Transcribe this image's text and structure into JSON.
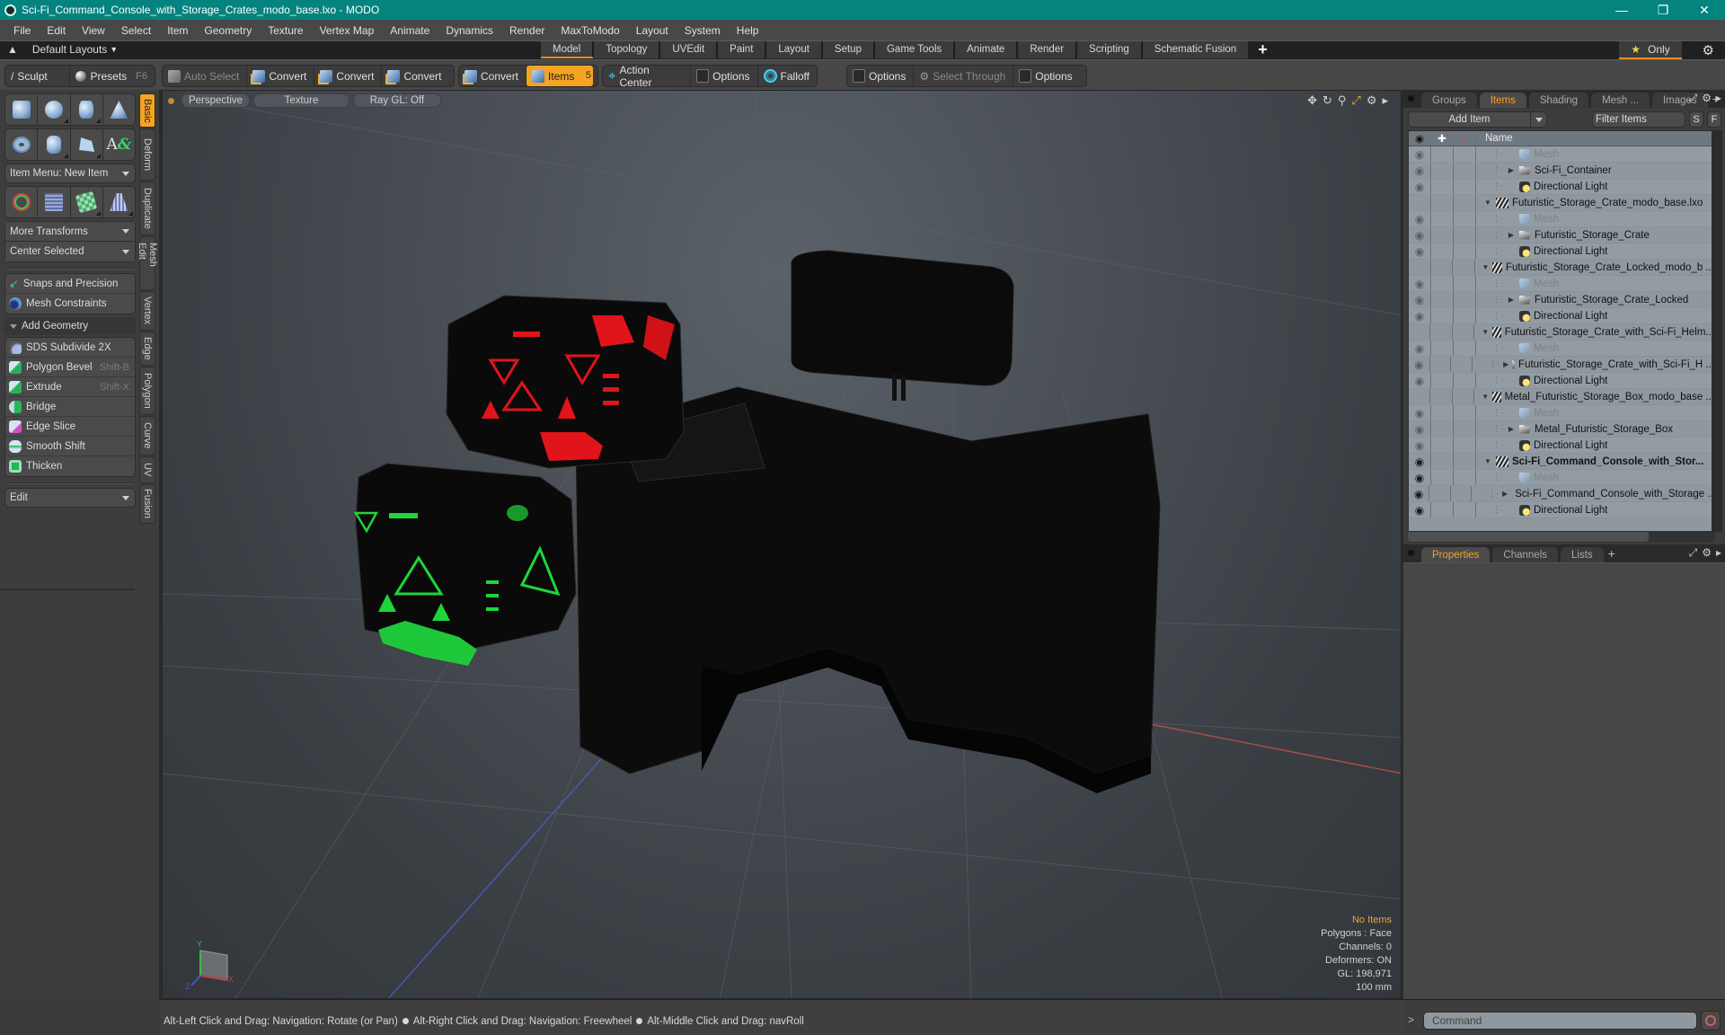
{
  "window": {
    "title": "Sci-Fi_Command_Console_with_Storage_Crates_modo_base.lxo - MODO",
    "controls": [
      "minimize",
      "maximize",
      "close"
    ]
  },
  "menu": [
    "File",
    "Edit",
    "View",
    "Select",
    "Item",
    "Geometry",
    "Texture",
    "Vertex Map",
    "Animate",
    "Dynamics",
    "Render",
    "MaxToModo",
    "Layout",
    "System",
    "Help"
  ],
  "layout_bar": {
    "layouts_label": "Default Layouts",
    "tabs": [
      {
        "label": "Model",
        "active": true
      },
      {
        "label": "Topology",
        "active": false
      },
      {
        "label": "UVEdit",
        "active": false
      },
      {
        "label": "Paint",
        "active": false
      },
      {
        "label": "Layout",
        "active": false
      },
      {
        "label": "Setup",
        "active": false
      },
      {
        "label": "Game Tools",
        "active": false
      },
      {
        "label": "Animate",
        "active": false
      },
      {
        "label": "Render",
        "active": false
      },
      {
        "label": "Scripting",
        "active": false
      },
      {
        "label": "Schematic Fusion",
        "active": false
      }
    ],
    "add_tab": "+",
    "only_label": "Only"
  },
  "toolbar": {
    "sculpt": "Sculpt",
    "presets": "Presets",
    "presets_hotkey": "F6",
    "auto_select": "Auto Select",
    "convert1": "Convert",
    "convert2": "Convert",
    "convert3": "Convert",
    "convert4": "Convert",
    "items": "Items",
    "items_count": "5",
    "action_center": "Action Center",
    "options1": "Options",
    "falloff": "Falloff",
    "options2": "Options",
    "select_through": "Select Through",
    "options3": "Options"
  },
  "left_panel": {
    "item_menu": "Item Menu: New Item",
    "more_transforms": "More Transforms",
    "center_selected": "Center Selected",
    "snaps": "Snaps and Precision",
    "mesh_constraints": "Mesh Constraints",
    "add_geometry": "Add Geometry",
    "tools": [
      {
        "label": "SDS Subdivide 2X",
        "hotkey": ""
      },
      {
        "label": "Polygon Bevel",
        "hotkey": "Shift-B"
      },
      {
        "label": "Extrude",
        "hotkey": "Shift-X"
      },
      {
        "label": "Bridge",
        "hotkey": ""
      },
      {
        "label": "Edge Slice",
        "hotkey": ""
      },
      {
        "label": "Smooth Shift",
        "hotkey": ""
      },
      {
        "label": "Thicken",
        "hotkey": ""
      }
    ],
    "edit_dropdown": "Edit",
    "vertical_tabs": [
      {
        "label": "Basic",
        "active": true
      },
      {
        "label": "Deform",
        "active": false
      },
      {
        "label": "Duplicate",
        "active": false
      },
      {
        "label": "Mesh Edit",
        "active": false
      },
      {
        "label": "Vertex",
        "active": false
      },
      {
        "label": "Edge",
        "active": false
      },
      {
        "label": "Polygon",
        "active": false
      },
      {
        "label": "Curve",
        "active": false
      },
      {
        "label": "UV",
        "active": false
      },
      {
        "label": "Fusion",
        "active": false
      }
    ]
  },
  "viewport": {
    "view": "Perspective",
    "shading": "Texture",
    "raygl": "Ray GL: Off",
    "stats": {
      "selection": "No Items",
      "polygons": "Polygons : Face",
      "channels": "Channels: 0",
      "deformers": "Deformers: ON",
      "gl": "GL: 198,971",
      "scale": "100 mm"
    },
    "axis_labels": {
      "x": "X",
      "y": "Y",
      "z": "Z"
    }
  },
  "right_panel": {
    "top_tabs": [
      {
        "label": "Groups",
        "active": false
      },
      {
        "label": "Items",
        "active": true
      },
      {
        "label": "Shading",
        "active": false
      },
      {
        "label": "Mesh ...",
        "active": false
      },
      {
        "label": "Images",
        "active": false
      }
    ],
    "add_item": "Add Item",
    "filter_items": "Filter Items",
    "s_btn": "S",
    "f_btn": "F",
    "column_name": "Name",
    "items": [
      {
        "name": "Mesh",
        "type": "mesh",
        "level": 2,
        "visible": true,
        "dim": true
      },
      {
        "name": "Sci-Fi_Container",
        "type": "group",
        "level": 2,
        "visible": true,
        "expandable": true
      },
      {
        "name": "Directional Light",
        "type": "light",
        "level": 2,
        "visible": true
      },
      {
        "name": "Futuristic_Storage_Crate_modo_base.lxo",
        "type": "scene",
        "level": 1,
        "visible": false,
        "expanded": true
      },
      {
        "name": "Mesh",
        "type": "mesh",
        "level": 2,
        "visible": true,
        "dim": true
      },
      {
        "name": "Futuristic_Storage_Crate",
        "type": "group",
        "level": 2,
        "visible": true,
        "expandable": true
      },
      {
        "name": "Directional Light",
        "type": "light",
        "level": 2,
        "visible": true
      },
      {
        "name": "Futuristic_Storage_Crate_Locked_modo_b ...",
        "type": "scene",
        "level": 1,
        "visible": false,
        "expanded": true
      },
      {
        "name": "Mesh",
        "type": "mesh",
        "level": 2,
        "visible": true,
        "dim": true
      },
      {
        "name": "Futuristic_Storage_Crate_Locked",
        "type": "group",
        "level": 2,
        "visible": true,
        "expandable": true
      },
      {
        "name": "Directional Light",
        "type": "light",
        "level": 2,
        "visible": true
      },
      {
        "name": "Futuristic_Storage_Crate_with_Sci-Fi_Helm...",
        "type": "scene",
        "level": 1,
        "visible": false,
        "expanded": true
      },
      {
        "name": "Mesh",
        "type": "mesh",
        "level": 2,
        "visible": true,
        "dim": true
      },
      {
        "name": "Futuristic_Storage_Crate_with_Sci-Fi_H ...",
        "type": "group",
        "level": 2,
        "visible": true,
        "expandable": true
      },
      {
        "name": "Directional Light",
        "type": "light",
        "level": 2,
        "visible": true
      },
      {
        "name": "Metal_Futuristic_Storage_Box_modo_base ...",
        "type": "scene",
        "level": 1,
        "visible": false,
        "expanded": true
      },
      {
        "name": "Mesh",
        "type": "mesh",
        "level": 2,
        "visible": true,
        "dim": true
      },
      {
        "name": "Metal_Futuristic_Storage_Box",
        "type": "group",
        "level": 2,
        "visible": true,
        "expandable": true
      },
      {
        "name": "Directional Light",
        "type": "light",
        "level": 2,
        "visible": true
      },
      {
        "name": "Sci-Fi_Command_Console_with_Stor...",
        "type": "scene",
        "level": 1,
        "visible": true,
        "expanded": true,
        "bold": true,
        "eye_dark": true
      },
      {
        "name": "Mesh",
        "type": "mesh",
        "level": 2,
        "visible": true,
        "dim": true,
        "eye_dark": true
      },
      {
        "name": "Sci-Fi_Command_Console_with_Storage ...",
        "type": "group",
        "level": 2,
        "visible": true,
        "expandable": true,
        "eye_dark": true
      },
      {
        "name": "Directional Light",
        "type": "light",
        "level": 2,
        "visible": true,
        "eye_dark": true
      }
    ],
    "bottom_tabs": [
      {
        "label": "Properties",
        "active": true
      },
      {
        "label": "Channels",
        "active": false
      },
      {
        "label": "Lists",
        "active": false
      }
    ]
  },
  "status_bar": {
    "hints": [
      "Alt-Left Click and Drag: Navigation: Rotate (or Pan)",
      "Alt-Right Click and Drag: Navigation: Freewheel",
      "Alt-Middle Click and Drag: navRoll"
    ]
  },
  "command": {
    "prompt": ">",
    "placeholder": "Command"
  },
  "colors": {
    "titlebar": "#05837f",
    "accent": "#f5a323",
    "crate_red": "#e0141a",
    "crate_green": "#1ed63a",
    "console": "#0d0d0d"
  }
}
